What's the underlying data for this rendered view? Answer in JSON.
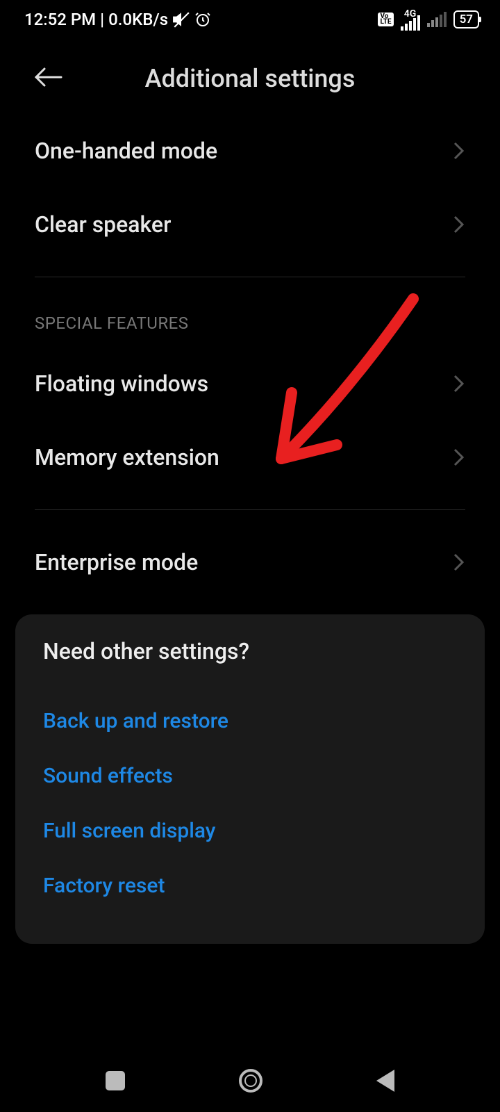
{
  "status": {
    "time": "12:52 PM",
    "data_rate": "0.0KB/s",
    "net_type": "4G",
    "volte": "Vo\nLTE",
    "battery": "57"
  },
  "header": {
    "title": "Additional settings"
  },
  "items": {
    "one_handed": "One-handed mode",
    "clear_speaker": "Clear speaker",
    "floating_windows": "Floating windows",
    "memory_extension": "Memory extension",
    "enterprise_mode": "Enterprise mode"
  },
  "sections": {
    "special_features": "SPECIAL FEATURES"
  },
  "card": {
    "title": "Need other settings?",
    "backup": "Back up and restore",
    "sound": "Sound effects",
    "fullscreen": "Full screen display",
    "factory": "Factory reset"
  }
}
